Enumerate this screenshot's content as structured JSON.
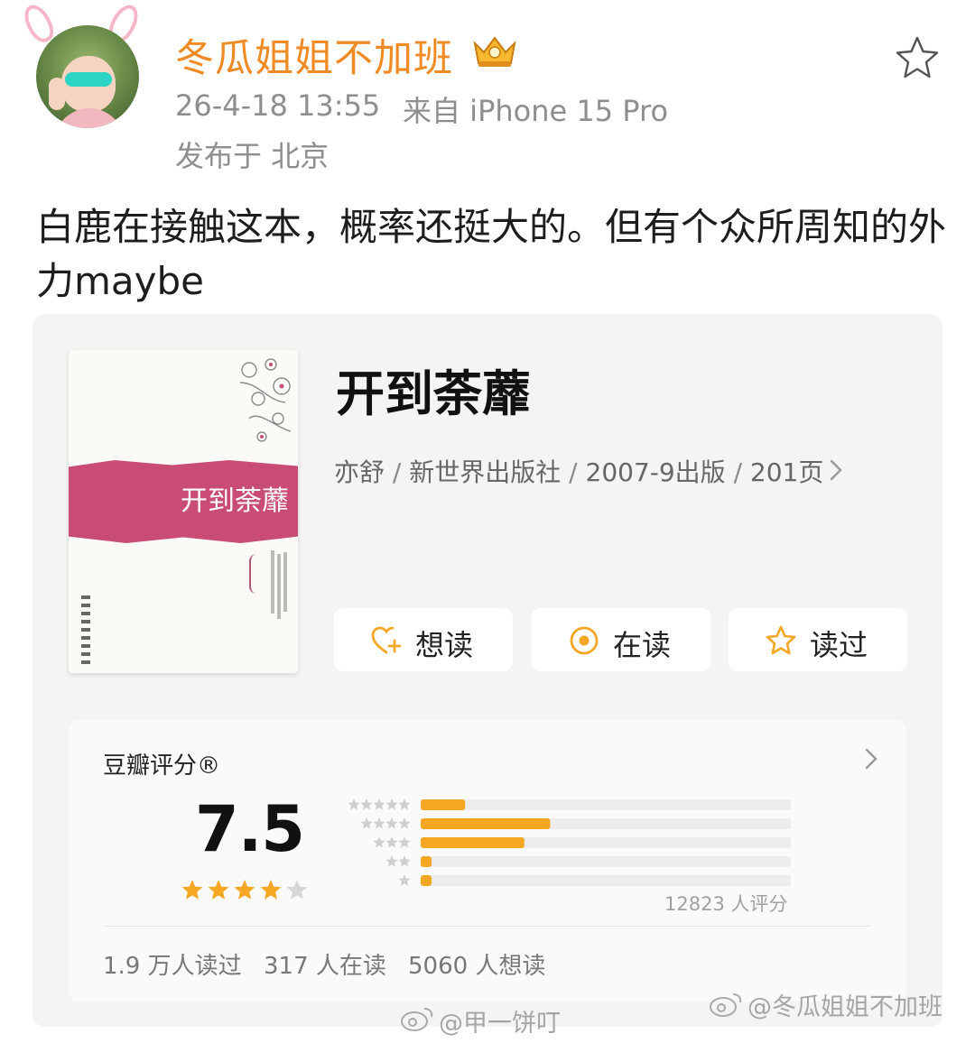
{
  "post": {
    "author": "冬瓜姐姐不加班",
    "timestamp": "26-4-18 13:55",
    "source": "来自 iPhone 15 Pro",
    "location": "发布于 北京",
    "text": "白鹿在接触这本，概率还挺大的。但有个众所周知的外力maybe"
  },
  "book": {
    "cover_title": "开到荼蘼",
    "title": "开到荼蘼",
    "author": "亦舒",
    "publisher": "新世界出版社",
    "published": "2007-9出版",
    "pages": "201页",
    "separator": " / ",
    "actions": [
      {
        "label": "想读",
        "icon": "heart-plus-icon"
      },
      {
        "label": "在读",
        "icon": "target-circle-icon"
      },
      {
        "label": "读过",
        "icon": "star-outline-icon"
      }
    ]
  },
  "rating": {
    "title": "豆瓣评分®",
    "score": "7.5",
    "stars": 4,
    "star_max": 5,
    "count": "12823 人评分",
    "distribution": [
      {
        "stars": 5,
        "percent": 12
      },
      {
        "stars": 4,
        "percent": 35
      },
      {
        "stars": 3,
        "percent": 28
      },
      {
        "stars": 2,
        "percent": 2
      },
      {
        "stars": 1,
        "percent": 1
      }
    ],
    "stats": {
      "read": "1.9 万人读过",
      "reading": "317 人在读",
      "want": "5060 人想读"
    }
  },
  "watermarks": {
    "left": "@甲一饼叮",
    "right": "@冬瓜姐姐不加班"
  },
  "colors": {
    "username": "#f08a24",
    "accent_orange": "#f5a623",
    "cover_band": "#c94c74",
    "muted_text": "#8e8e8e"
  }
}
